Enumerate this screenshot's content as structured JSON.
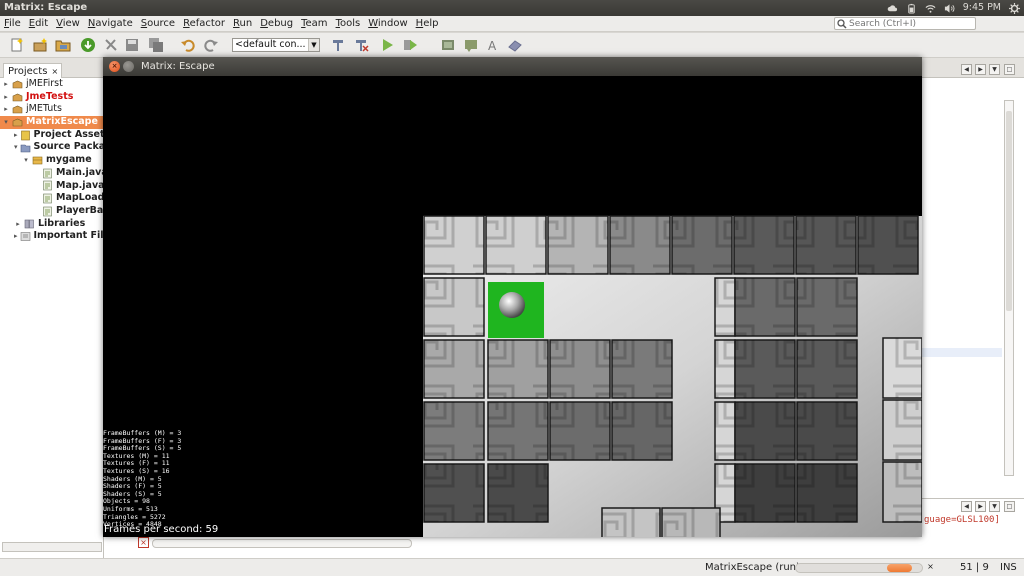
{
  "window_title": "Matrix: Escape",
  "tray": {
    "time": "9:45 PM"
  },
  "menu": {
    "items": [
      {
        "label": "File",
        "key": "F",
        "rest": "ile"
      },
      {
        "label": "Edit",
        "key": "E",
        "rest": "dit"
      },
      {
        "label": "View",
        "key": "V",
        "rest": "iew"
      },
      {
        "label": "Navigate",
        "key": "N",
        "rest": "avigate"
      },
      {
        "label": "Source",
        "key": "S",
        "rest": "ource"
      },
      {
        "label": "Refactor",
        "key": "R",
        "rest": "efactor"
      },
      {
        "label": "Run",
        "key": "R",
        "rest": "un"
      },
      {
        "label": "Debug",
        "key": "D",
        "rest": "ebug"
      },
      {
        "label": "Team",
        "key": "T",
        "rest": "eam"
      },
      {
        "label": "Tools",
        "key": "T",
        "rest": "ools"
      },
      {
        "label": "Window",
        "key": "W",
        "rest": "indow"
      },
      {
        "label": "Help",
        "key": "H",
        "rest": "elp"
      }
    ],
    "search_placeholder": "Search (Ctrl+I)"
  },
  "toolbar": {
    "config_value": "<default con...",
    "icons": [
      "new-file-icon",
      "new-project-icon",
      "open-project-icon",
      "download-icon",
      "clean-build-icon",
      "save-icon",
      "save-all-icon",
      "undo-icon",
      "redo-icon",
      "build-icon",
      "clean-icon",
      "run-icon",
      "debug-icon",
      "profile-icon",
      "gui-builder-icon",
      "comment-icon",
      "font-icon",
      "cloud-icon"
    ]
  },
  "projects": {
    "tab_label": "Projects",
    "tab_close": "×",
    "tree": [
      {
        "label": "jMEFirst",
        "toggle": "▸",
        "icon": "project-icon",
        "style": ""
      },
      {
        "label": "JmeTests",
        "toggle": "▸",
        "icon": "project-icon",
        "style": "red"
      },
      {
        "label": "jMETuts",
        "toggle": "▸",
        "icon": "project-icon",
        "style": ""
      },
      {
        "label": "MatrixEscape",
        "toggle": "▾",
        "icon": "project-icon",
        "style": "sel"
      },
      {
        "label": "Project Assets",
        "toggle": "▸",
        "icon": "assets-icon",
        "style": "bold"
      },
      {
        "label": "Source Packages",
        "toggle": "▾",
        "icon": "source-packages-icon",
        "style": "bold"
      },
      {
        "label": "mygame",
        "toggle": "▾",
        "icon": "package-icon",
        "style": "bold"
      },
      {
        "label": "Main.java",
        "toggle": "",
        "icon": "java-file-icon",
        "style": "bold"
      },
      {
        "label": "Map.java",
        "toggle": "",
        "icon": "java-file-icon",
        "style": "bold"
      },
      {
        "label": "MapLoader.java",
        "toggle": "",
        "icon": "java-file-icon",
        "style": "bold"
      },
      {
        "label": "PlayerBall.java",
        "toggle": "",
        "icon": "java-file-icon",
        "style": "bold"
      },
      {
        "label": "Libraries",
        "toggle": "▸",
        "icon": "libraries-icon",
        "style": "bold"
      },
      {
        "label": "Important Files",
        "toggle": "▸",
        "icon": "important-files-icon",
        "style": "bold"
      }
    ]
  },
  "editor": {
    "output_text": "guage=GLSL100]",
    "stop_label": "×"
  },
  "status": {
    "run_label": "MatrixEscape (run)",
    "progress_fraction": 0.2,
    "progress_close": "×",
    "position": "51 | 9",
    "mode": "INS"
  },
  "game": {
    "stats": [
      "FrameBuffers (M) = 3",
      "FrameBuffers (F) = 3",
      "FrameBuffers (S) = 5",
      "Textures (M) = 11",
      "Textures (F) = 11",
      "Textures (S) = 16",
      "Shaders (M) = 5",
      "Shaders (F) = 5",
      "Shaders (S) = 5",
      "Objects = 98",
      "Uniforms = 513",
      "Triangles = 5272",
      "Vertices = 4848"
    ],
    "fps_text": "Frames per second: 59"
  }
}
